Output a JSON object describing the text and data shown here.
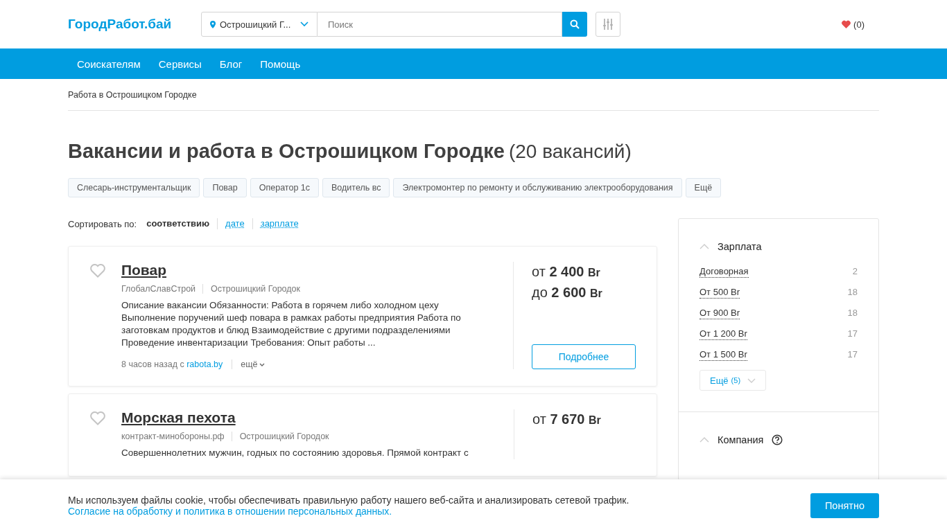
{
  "header": {
    "logo": "ГородРабот.бай",
    "location": "Острошицкий Г...",
    "search": {
      "placeholder": "Поиск"
    },
    "favorites_count": "(0)"
  },
  "nav": [
    "Соискателям",
    "Сервисы",
    "Блог",
    "Помощь"
  ],
  "breadcrumb": "Работа в Острошицком Городке",
  "title": "Вакансии и работа в Острошицком Городке",
  "title_count": "(20 вакансий)",
  "tags": [
    "Слесарь-инструментальщик",
    "Повар",
    "Оператор 1с",
    "Водитель вс",
    "Электромонтер по ремонту и обслуживанию электрооборудования",
    "Ещё"
  ],
  "sort": {
    "label": "Сортировать по:",
    "options": [
      {
        "label": "соответствию",
        "selected": true
      },
      {
        "label": "дате",
        "selected": false
      },
      {
        "label": "зарплате",
        "selected": false
      }
    ]
  },
  "vacancies": [
    {
      "title": "Повар",
      "company": "ГлобалСлавСтрой",
      "location": "Острошицкий Городок",
      "description": "Описание вакансии Обязанности: Работа в горячем либо холодном цеху Выполнение поручений шеф повара в рамках работы предприятия Работа по заготовкам продуктов и блюд Взаимодействие с другими подразделениями Проведение инвентаризации Требования: Опыт работы ...",
      "posted": "8 часов назад с",
      "source": "rabota.by",
      "more": "ещё",
      "salary": [
        {
          "prefix": "от",
          "amount": "2 400",
          "currency": "Br"
        },
        {
          "prefix": "до",
          "amount": "2 600",
          "currency": "Br"
        }
      ],
      "button": "Подробнее",
      "favorite": false
    },
    {
      "title": "Морская пехота",
      "company": "контракт-минобороны.рф",
      "location": "Острошицкий Городок",
      "description": "Совершеннолетних мужчин, годных по состоянию здоровья. Прямой контракт с",
      "salary": [
        {
          "prefix": "от",
          "amount": "7 670",
          "currency": "Br"
        }
      ],
      "favorite": false
    }
  ],
  "filters": [
    {
      "title": "Зарплата",
      "expanded": true,
      "help": false,
      "options": [
        {
          "label": "Договорная",
          "count": "2"
        },
        {
          "label": "От 500 Br",
          "count": "18"
        },
        {
          "label": "От 900 Br",
          "count": "18"
        },
        {
          "label": "От 1 200 Br",
          "count": "17"
        },
        {
          "label": "От 1 500 Br",
          "count": "17"
        }
      ],
      "more": "Ещё",
      "more_count": "(5)"
    },
    {
      "title": "Компания",
      "expanded": true,
      "help": true
    }
  ],
  "cookie": {
    "text": "Мы используем файлы cookie, чтобы обеспечивать правильную работу нашего веб-сайта и анализировать сетевой трафик.",
    "link": "Согласие на обработку и политика в отношении персональных данных.",
    "button": "Понятно"
  }
}
